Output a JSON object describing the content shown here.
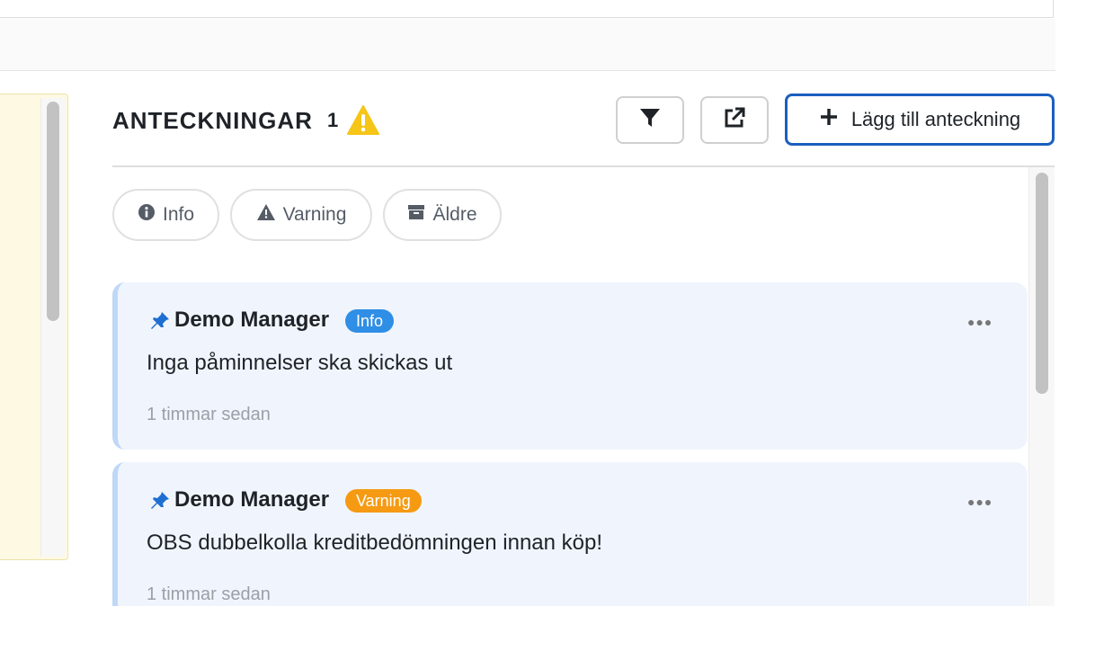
{
  "notes": {
    "title": "ANTECKNINGAR",
    "count": "1",
    "add_label": "Lägg till anteckning",
    "filters": [
      {
        "label": "Info",
        "icon": "info-circle-icon"
      },
      {
        "label": "Varning",
        "icon": "warning-triangle-icon"
      },
      {
        "label": "Äldre",
        "icon": "archive-icon"
      }
    ],
    "items": [
      {
        "author": "Demo Manager",
        "badge": "Info",
        "badge_color": "#2f8ee5",
        "text": "Inga påminnelser ska skickas ut",
        "time": "1 timmar sedan"
      },
      {
        "author": "Demo Manager",
        "badge": "Varning",
        "badge_color": "#f59a12",
        "text": "OBS dubbelkolla kreditbedömningen innan köp!",
        "time": "1 timmar sedan"
      }
    ]
  },
  "colors": {
    "accent": "#1b5fbf",
    "warning": "#f5c518",
    "pin": "#1f6fd1",
    "card_bg": "#f0f5fd"
  }
}
